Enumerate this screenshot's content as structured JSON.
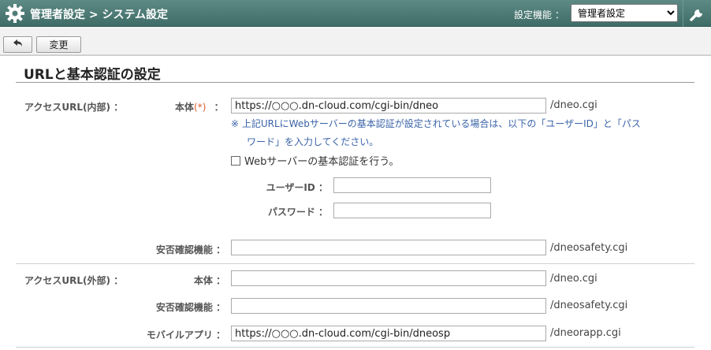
{
  "header": {
    "title": "管理者設定 > システム設定",
    "function_label": "設定機能 ：",
    "function_select": "管理者設定",
    "colors": {
      "bar": "#4f7c77"
    }
  },
  "toolbar": {
    "back_icon": "back-arrow-icon",
    "change_label": "変更"
  },
  "section": {
    "title": "URLと基本認証の設定"
  },
  "internal": {
    "group_label": "アクセスURL(内部) ：",
    "main_label": "本体",
    "required": "(*)",
    "colon": "：",
    "main_value": "https://○○○.dn-cloud.com/cgi-bin/dneo",
    "main_suffix": "/dneo.cgi",
    "note_line1": "※ 上記URLにWebサーバーの基本認証が設定されている場合は、以下の「ユーザーID」と「パス",
    "note_line2": "ワード」を入力してください。",
    "basic_auth_label": "Webサーバーの基本認証を行う。",
    "user_id_label": "ユーザーID ：",
    "user_id_value": "",
    "password_label": "パスワード ：",
    "password_value": "",
    "safety_label": "安否確認機能 ：",
    "safety_value": "",
    "safety_suffix": "/dneosafety.cgi"
  },
  "external": {
    "group_label": "アクセスURL(外部) ：",
    "main_label": "本体 ：",
    "main_value": "",
    "main_suffix": "/dneo.cgi",
    "safety_label": "安否確認機能 ：",
    "safety_value": "",
    "safety_suffix": "/dneosafety.cgi",
    "mobile_label": "モバイルアプリ ：",
    "mobile_value": "https://○○○.dn-cloud.com/cgi-bin/dneosp",
    "mobile_suffix": "/dneorapp.cgi"
  }
}
